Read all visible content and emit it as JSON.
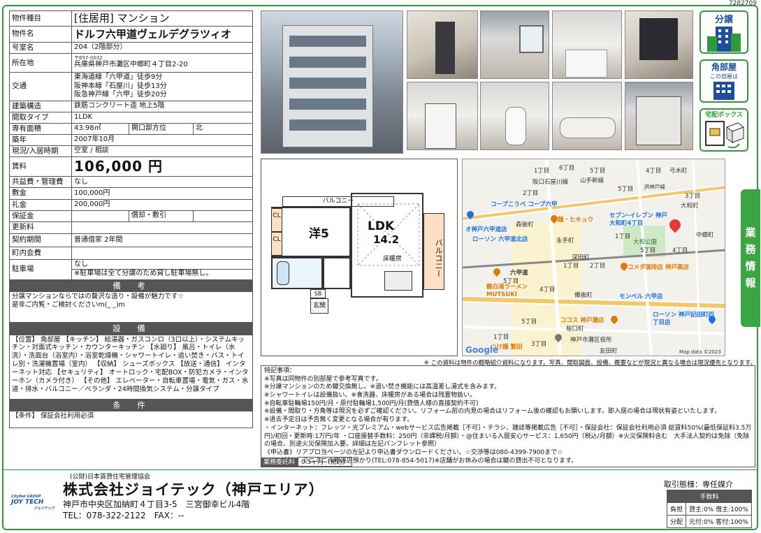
{
  "doc_id": "7282709",
  "property": {
    "type_label": "物件種目",
    "type": "[住居用] マンション",
    "name_label": "物件名",
    "name": "ドルフ六甲道ヴェルデグラツィオ",
    "room_label": "号室名",
    "room": "204（2階部分）",
    "address_label": "所在地",
    "postal": "〒657-0032",
    "address": "兵庫県神戸市灘区中郷町４丁目2-20",
    "transport_label": "交通",
    "transport": [
      "東海道線「六甲道」徒歩9分",
      "阪神本線「石屋川」徒歩13分",
      "阪急神戸線「六甲」徒歩20分"
    ],
    "structure_label": "建築構造",
    "structure": "鉄筋コンクリート造 地上5階",
    "layout_label": "間取タイプ",
    "layout": "1LDK",
    "area_label": "専有面積",
    "area": "43.98㎡",
    "direction_label": "開口部方位",
    "direction": "北",
    "built_label": "築年",
    "built": "2007年10月",
    "status_label": "現況/入居時期",
    "status": "空室 / 相談",
    "rent_label": "賃料",
    "rent": "106,000 円",
    "common_label": "共益費・管理費",
    "common": "なし",
    "deposit_label": "敷金",
    "deposit": "100,000円",
    "keymoney_label": "礼金",
    "keymoney": "200,000円",
    "guarantee_label": "保証金",
    "guarantee_amort_label": "償却・敷引",
    "renewal_label": "更新料",
    "contract_label": "契約期間",
    "contract": "普通借家 2年間",
    "assoc_label": "町内会費",
    "parking_label": "駐車場",
    "parking": "なし",
    "parking_note": "※駐車場は全て分譲のため貸し駐車場無し。"
  },
  "remarks": {
    "title": "備　考",
    "text": "分譲マンションならではの贅沢な造り・設備が魅力です☆\n是非ご内覧・ご検討くださいm(_ _)m"
  },
  "equipment": {
    "title": "設　備",
    "text": "【位置】 角部屋 【キッチン】 給湯器・ガスコンロ（3口以上）・システムキッチン・対面式キッチン・カウンターキッチン 【水廻り】 風呂・トイレ（水洗）・洗面台（浴室内）・浴室乾燥機・シャワートイレ・追い焚き・バス・トイレ別・洗濯機置場（室内） 【収納】 シューズボックス 【放送・通信】 インターネット対応 【セキュリティ】 オートロック・宅配BOX・防犯カメラ・インターホン（カメラ付き） 【その他】 エレベーター・自転車置場・電気・ガス・水道・排水・バルコニー／ベランダ・24時間換気システム・分譲タイプ"
  },
  "conditions": {
    "title": "条　件",
    "text": "【条件】 保証会社利用必須"
  },
  "badges": {
    "bunjo": "分譲",
    "kado": "角部屋",
    "kado_sub": "この部屋は",
    "takuhai": "宅配ボックス"
  },
  "floorplan": {
    "balcony_top": "バルコニー",
    "balcony_side": "バルコニー",
    "cl": "CL",
    "room1": "洋5",
    "ldk": "LDK",
    "ldk_size": "14.2",
    "floor_heat": "床暖房",
    "sb": "SB",
    "entrance": "玄関"
  },
  "map": {
    "labels": [
      "1丁目",
      "6丁目",
      "5丁目",
      "4丁目",
      "弓木町",
      "阪口石屋川線",
      "山手幹線",
      "2丁目",
      "5丁目",
      "3丁目",
      "JR神戸線",
      "コープこうべ コープ六甲",
      "大和町",
      "オ神戸六甲道店",
      "森後町",
      "麺・ヒキュウ",
      "セブン-イレブン 神戸大和町4丁目",
      "ローソン 六甲道北店",
      "永手町",
      "1丁目",
      "中郷町",
      "大和公園",
      "深田町",
      "5丁目",
      "4丁目",
      "六甲道",
      "1丁目",
      "2丁目",
      "コメダ珈琲店 神戸高店",
      "5丁目",
      "鶴白湯ラーメン MUTSUKI",
      "4丁目",
      "備後町",
      "モンベル 六甲店",
      "5丁目",
      "ココス 神戸灘店",
      "桜口町",
      "ローソン 神戸記田町四丁目店",
      "1丁目",
      "神戸市灘区役所",
      "3丁目",
      "つけ麺 繁田",
      "友田町",
      "Map data ©2023"
    ],
    "google": "Google"
  },
  "vtab": [
    "業",
    "務",
    "情",
    "報"
  ],
  "disclaimer": "※ この資料は物件の概略紹介資料になります。写真、間取図面、設備、概要などが現況と異なる場合は現況優先となります。",
  "special": {
    "title": "特記事項：",
    "lines": [
      "※写真は同物件の別部屋で参考写真です。",
      "※分譲マンションのため鍵交換無し。※追い焚き機能には高温差し湯式を含みます。",
      "※シャワートイレは設備扱い。※食洗器、床暖房がある場合は残置物扱い。",
      "※自転車駐輪場150円/月・原付駐輪場1,500円/月(貸借人様の直接契約不可)",
      "※設備・間取り・方角等は現況を必ずご確認ください。リフォーム前の内見の場合はリフォーム後の確認もお願いします。即入居の場合は現状有姿といたします。",
      "※退去予定日は予告無く変更となる場合が有ります。",
      "・インターネット：フレッツ・光プレミアム・webサービス広告掲載［不可］・チラシ、雑誌等掲載広告［不可］・保証会社：保証会社利用必須 総賃料50%(最低保証料3.5万円)/初回・更新時:1万円/年 ・口座振替手数料：250円（非課税/月額）・@住まいる入居安心サービス：1,650円（税込/月額）※火災保険料含む　大手法人契約は免除（免除の場合、別途火災保険加入要。詳細は左記パンフレット参照）",
      "《申込書》リアプロ当ページの左記より申込書ダウンロードください。☆交渉等は080-4399-7900まで☆",
      "◆ カギ所在：ミニミニ六甲道店預かり(TEL:078-854-5017)※店舗がお休みの場合は鍵の貸出不可となります。"
    ]
  },
  "fee": {
    "label": "業務委託料",
    "value": "0.5ヶ月（税込）"
  },
  "company": {
    "org": "(公財)日本賃貸住宅管理協会",
    "name": "株式会社ジョイテック（神戸エリア）",
    "address": "神戸市中央区加納町４丁目3-5　三宮御幸ビル4階",
    "tel": "TEL：078-322-2122　FAX：--",
    "logo_top": "CityNet GROUP",
    "logo_main": "JOY TECH",
    "logo_sub": "ジョイテック"
  },
  "deal": {
    "type": "取引態様：専任媒介",
    "fee_header": "手数料",
    "rows": [
      {
        "label": "負担",
        "value": "貸主:0%  借主:100%"
      },
      {
        "label": "分配",
        "value": "元付:0%  客付:100%"
      }
    ]
  },
  "colors": {
    "frame": "#2e9b3a",
    "bar": "#555555",
    "accent": "#3ba544"
  }
}
